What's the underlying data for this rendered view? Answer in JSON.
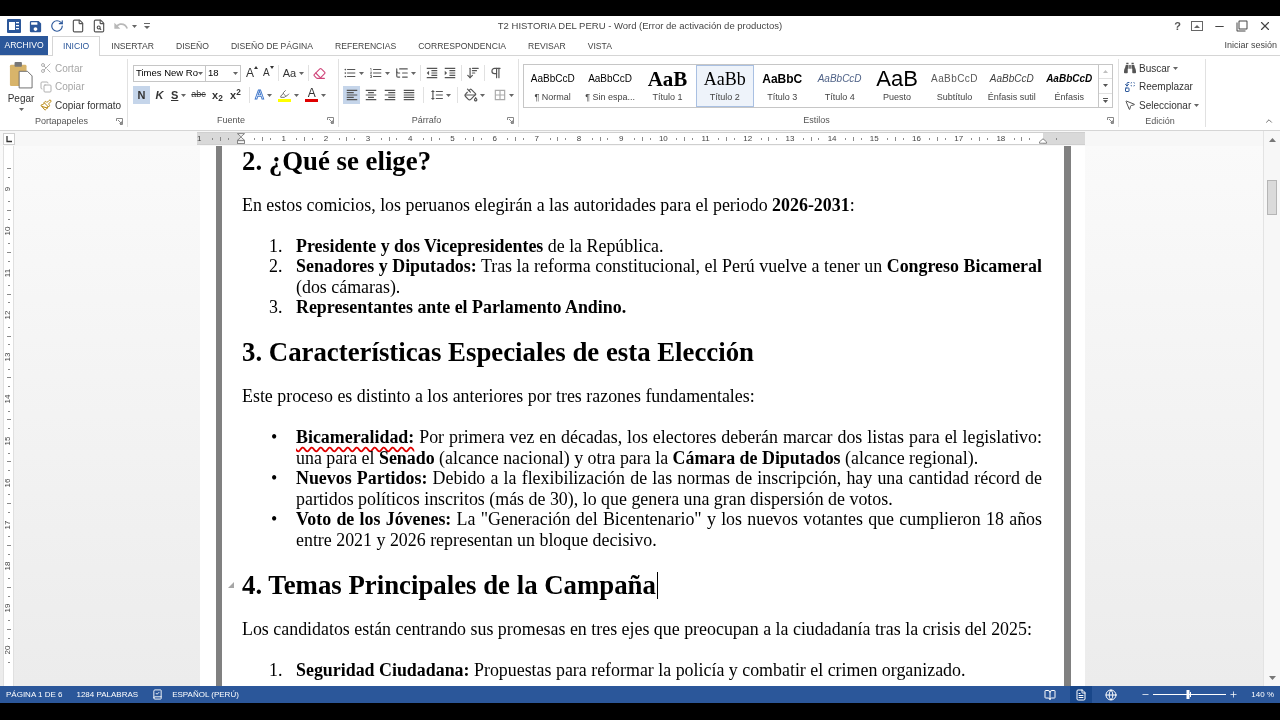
{
  "window": {
    "title": "T2 HISTORIA DEL PERU - Word (Error de activación de productos)",
    "help": "?",
    "sign_in": "Iniciar sesión"
  },
  "quick_access": {
    "undo": {
      "disabled": true
    }
  },
  "tabs": [
    {
      "label": "ARCHIVO",
      "kind": "file",
      "selected": false
    },
    {
      "label": "INICIO",
      "kind": "tab",
      "selected": true
    },
    {
      "label": "INSERTAR",
      "kind": "tab",
      "selected": false
    },
    {
      "label": "DISEÑO",
      "kind": "tab",
      "selected": false
    },
    {
      "label": "DISEÑO DE PÁGINA",
      "kind": "tab",
      "selected": false
    },
    {
      "label": "REFERENCIAS",
      "kind": "tab",
      "selected": false
    },
    {
      "label": "CORRESPONDENCIA",
      "kind": "tab",
      "selected": false
    },
    {
      "label": "REVISAR",
      "kind": "tab",
      "selected": false
    },
    {
      "label": "VISTA",
      "kind": "tab",
      "selected": false
    }
  ],
  "ribbon": {
    "clipboard": {
      "paste": "Pegar",
      "commands": [
        {
          "kind": "cut",
          "label": "Cortar",
          "disabled": true
        },
        {
          "kind": "copy",
          "label": "Copiar",
          "disabled": true
        },
        {
          "kind": "format_painter",
          "label": "Copiar formato",
          "disabled": false
        }
      ],
      "group_label": "Portapapeles"
    },
    "font": {
      "font_name": "Times New Ro",
      "font_size": "18",
      "grow": "A",
      "shrink": "A",
      "change_case": "Aa",
      "formats": [
        {
          "kind": "bold",
          "label": "N",
          "selected": true
        },
        {
          "kind": "italic",
          "label": "K",
          "selected": false
        },
        {
          "kind": "underline",
          "label": "S",
          "selected": false
        },
        {
          "kind": "strikethrough",
          "label": "abc",
          "selected": false
        },
        {
          "kind": "subscript",
          "label": "x$_{2}$",
          "selected": false
        },
        {
          "kind": "superscript",
          "label": "x$^{2}$",
          "selected": false
        }
      ],
      "text_effects": "A",
      "font_color": "A",
      "group_label": "Fuente"
    },
    "paragraph": {
      "alignment": [
        {
          "kind": "left",
          "selected": true
        },
        {
          "kind": "center",
          "selected": false
        },
        {
          "kind": "right",
          "selected": false
        },
        {
          "kind": "justify",
          "selected": false
        }
      ],
      "group_label": "Párrafo"
    },
    "styles": {
      "items": [
        {
          "kind": "normal",
          "preview": "AaBbCcD",
          "name": "¶ Normal",
          "selected": false
        },
        {
          "kind": "no_spacing",
          "preview": "AaBbCcD",
          "name": "¶ Sin espa...",
          "selected": false
        },
        {
          "kind": "heading1",
          "preview": "AaB",
          "name": "Título 1",
          "selected": false
        },
        {
          "kind": "heading2",
          "preview": "AaBb",
          "name": "Título 2",
          "selected": true
        },
        {
          "kind": "heading3",
          "preview": "AaBbC",
          "name": "Título 3",
          "selected": false
        },
        {
          "kind": "heading4",
          "preview": "AaBbCcD",
          "name": "Título 4",
          "selected": false
        },
        {
          "kind": "title",
          "preview": "AaB",
          "name": "Puesto",
          "selected": false
        },
        {
          "kind": "subtitle",
          "preview": "AaBbCcD",
          "name": "Subtítulo",
          "selected": false
        },
        {
          "kind": "subtle_emphasis",
          "preview": "AaBbCcD",
          "name": "Énfasis sutil",
          "selected": false
        },
        {
          "kind": "emphasis",
          "preview": "AaBbCcD",
          "name": "Énfasis",
          "selected": false
        }
      ],
      "group_label": "Estilos"
    },
    "editing": {
      "commands": [
        {
          "kind": "find",
          "label": "Buscar"
        },
        {
          "kind": "replace",
          "label": "Reemplazar"
        },
        {
          "kind": "select",
          "label": "Seleccionar"
        }
      ],
      "group_label": "Edición"
    }
  },
  "ruler": {
    "horizontal": [
      "1",
      "1",
      "2",
      "3",
      "4",
      "5",
      "6",
      "7",
      "8",
      "9",
      "10",
      "11",
      "12",
      "13",
      "14",
      "15",
      "16",
      "17",
      "18"
    ],
    "vertical": [
      "9",
      "10",
      "11",
      "12",
      "13",
      "14",
      "15",
      "16",
      "17",
      "18",
      "19",
      "20"
    ]
  },
  "document": {
    "blocks": [
      {
        "kind": "heading",
        "text": "2. ¿Qué se elige?",
        "collapse_marker": false,
        "cursor": false
      },
      {
        "kind": "paragraph",
        "text": "En estos comicios, los peruanos elegirán a las autoridades para el periodo **2026-2031**:"
      },
      {
        "kind": "numbered",
        "items": [
          {
            "marker": "1.",
            "text": "**Presidente y dos Vicepresidentes** de la República."
          },
          {
            "marker": "2.",
            "text": "**Senadores y Diputados:** Tras la reforma constitucional, el Perú vuelve a tener un **Congreso Bicameral** (dos cámaras)."
          },
          {
            "marker": "3.",
            "text": "**Representantes ante el Parlamento Andino.**"
          }
        ]
      },
      {
        "kind": "heading",
        "text": "3. Características Especiales de esta Elección",
        "collapse_marker": false,
        "cursor": false
      },
      {
        "kind": "paragraph",
        "text": "Este proceso es distinto a los anteriores por tres razones fundamentales:"
      },
      {
        "kind": "bulleted",
        "items": [
          {
            "marker": "•",
            "term": "Bicameralidad:",
            "misspelled": true,
            "text": "Por primera vez en décadas, los electores deberán marcar dos listas para el legislativo: una para el **Senado** (alcance nacional) y otra para la **Cámara de Diputados** (alcance regional)."
          },
          {
            "marker": "•",
            "term": "Nuevos Partidos:",
            "misspelled": false,
            "text": "Debido a la flexibilización de las normas de inscripción, hay una cantidad récord de partidos políticos inscritos (más de 30), lo que genera una gran dispersión de votos."
          },
          {
            "marker": "•",
            "term": "Voto de los Jóvenes:",
            "misspelled": false,
            "text": "La \"Generación del Bicentenario\" y los nuevos votantes que cumplieron 18 años entre 2021 y 2026 representan un bloque decisivo."
          }
        ]
      },
      {
        "kind": "heading",
        "text": "4. Temas Principales de la Campaña",
        "collapse_marker": true,
        "cursor": true
      },
      {
        "kind": "paragraph",
        "text": "Los candidatos están centrando sus promesas en tres ejes que preocupan a la ciudadanía tras la crisis del 2025:"
      },
      {
        "kind": "numbered",
        "items": [
          {
            "marker": "1.",
            "text": "**Seguridad Ciudadana:** Propuestas para reformar la policía y combatir el crimen organizado."
          }
        ]
      }
    ]
  },
  "status_bar": {
    "page": "PÁGINA 1 DE 6",
    "words": "1284 PALABRAS",
    "language": "ESPAÑOL (PERÚ)",
    "views": [
      {
        "kind": "read",
        "selected": false
      },
      {
        "kind": "print",
        "selected": true
      },
      {
        "kind": "web",
        "selected": false
      }
    ],
    "zoom": {
      "level": 0.48,
      "reading": "140 %"
    }
  }
}
